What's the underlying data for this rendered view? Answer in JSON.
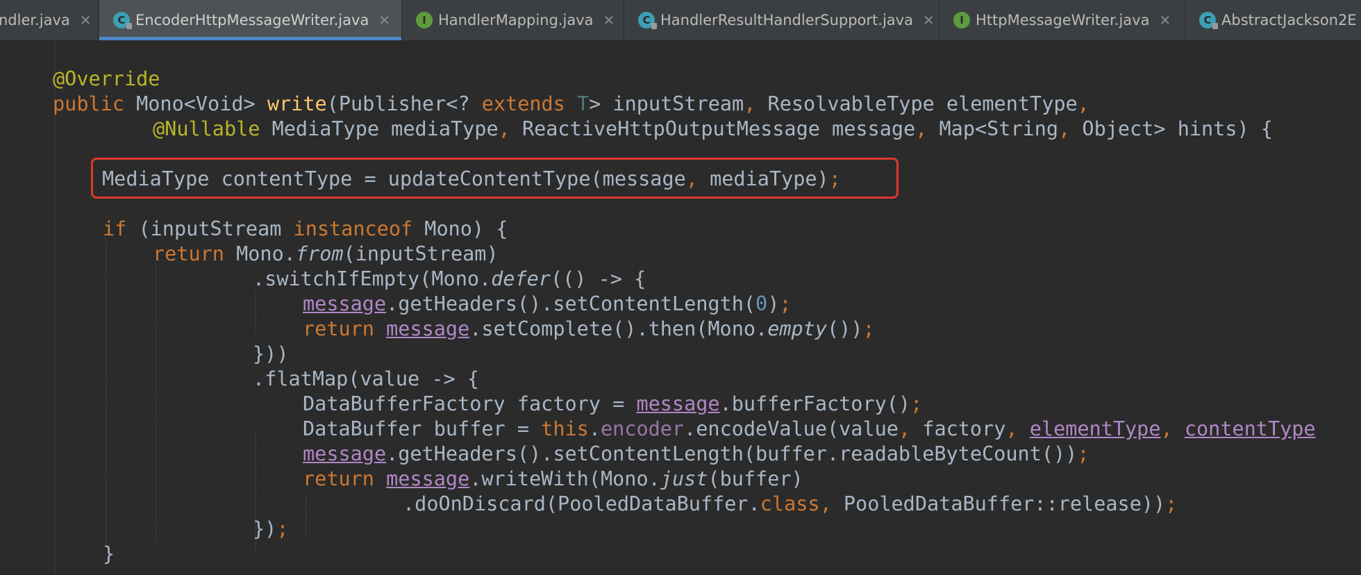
{
  "tabs": [
    {
      "label": "ndler.java",
      "icon": "none",
      "active": false
    },
    {
      "label": "EncoderHttpMessageWriter.java",
      "icon": "class-icon",
      "active": true
    },
    {
      "label": "HandlerMapping.java",
      "icon": "interface-icon",
      "active": false
    },
    {
      "label": "HandlerResultHandlerSupport.java",
      "icon": "class-icon",
      "active": false
    },
    {
      "label": "HttpMessageWriter.java",
      "icon": "interface-icon",
      "active": false
    },
    {
      "label": "AbstractJackson2E",
      "icon": "class-icon",
      "active": false
    }
  ],
  "tab_close_glyph": "✕",
  "code": {
    "l1_ann": "@Override",
    "l2_public": "public",
    "l2_mono": " Mono<Void> ",
    "l2_write": "write",
    "l2_pub": "(Publisher<? ",
    "l2_extends": "extends",
    "l2_T": " T",
    "l2_rest": "> inputStream",
    "l2_comma": ",",
    "l2_rest2": " ResolvableType elementType",
    "l2_comma2": ",",
    "l3_ann": "@Nullable",
    "l3_a": " MediaType mediaType",
    "l3_c1": ",",
    "l3_b": " ReactiveHttpOutputMessage message",
    "l3_c2": ",",
    "l3_c": " Map<String",
    "l3_c3": ",",
    "l3_d": " Object> hints) {",
    "l4_a": "MediaType contentType = updateContentType(message",
    "l4_c": ",",
    "l4_b": " mediaType)",
    "l4_semi": ";",
    "l5_if": "if",
    "l5_a": " (inputStream ",
    "l5_inst": "instanceof",
    "l5_b": " Mono) {",
    "l6_ret": "return",
    "l6_a": " Mono.",
    "l6_from": "from",
    "l6_b": "(inputStream)",
    "l7_a": ".switchIfEmpty(Mono.",
    "l7_defer": "defer",
    "l7_b": "(() -> {",
    "l8_msg": "message",
    "l8_a": ".getHeaders().setContentLength(",
    "l8_num": "0",
    "l8_b": ")",
    "l8_semi": ";",
    "l9_ret": "return",
    "l9_sp": " ",
    "l9_msg": "message",
    "l9_a": ".setComplete().then(Mono.",
    "l9_empty": "empty",
    "l9_b": "())",
    "l9_semi": ";",
    "l10": "}))",
    "l11": ".flatMap(value -> {",
    "l12_a": "DataBufferFactory factory = ",
    "l12_msg": "message",
    "l12_b": ".bufferFactory()",
    "l12_semi": ";",
    "l13_a": "DataBuffer buffer = ",
    "l13_this": "this",
    "l13_dot": ".",
    "l13_enc": "encoder",
    "l13_b": ".encodeValue(value",
    "l13_c1": ",",
    "l13_c": " factory",
    "l13_c2": ",",
    "l13_sp1": " ",
    "l13_et": "elementType",
    "l13_c3": ",",
    "l13_sp2": " ",
    "l13_ct": "contentType",
    "l14_msg": "message",
    "l14_a": ".getHeaders().setContentLength(buffer.readableByteCount())",
    "l14_semi": ";",
    "l15_ret": "return",
    "l15_sp": " ",
    "l15_msg": "message",
    "l15_a": ".writeWith(Mono.",
    "l15_just": "just",
    "l15_b": "(buffer)",
    "l16_a": ".doOnDiscard(PooledDataBuffer.",
    "l16_class": "class",
    "l16_c": ",",
    "l16_b": " PooledDataBuffer::release))",
    "l16_semi": ";",
    "l17_a": "})",
    "l17_semi": ";",
    "l18": "}"
  },
  "colors": {
    "background": "#2b2b2b",
    "keyword": "#cc7832",
    "annotation": "#bbb529",
    "method": "#ffc66d",
    "number": "#6897bb",
    "field": "#9876aa",
    "highlight_box": "#e0382c",
    "active_tab_underline": "#4a88c7"
  }
}
